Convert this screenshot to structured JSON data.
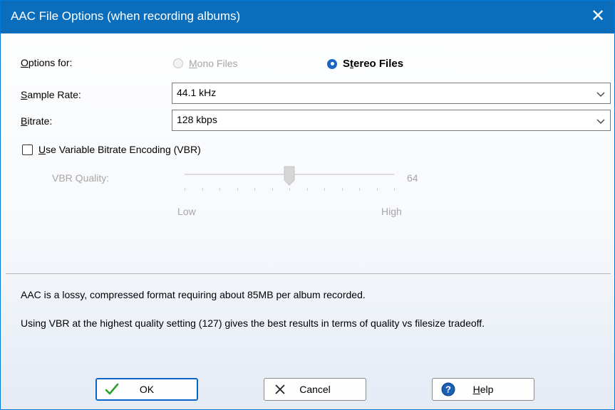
{
  "window": {
    "title": "AAC File Options (when recording albums)",
    "close_glyph": "✕"
  },
  "options_for": {
    "label": "Options for:",
    "mono_label": "Mono Files",
    "mono_selected": false,
    "mono_enabled": false,
    "stereo_label": "Stereo Files",
    "stereo_selected": true
  },
  "sample_rate": {
    "label": "Sample Rate:",
    "value": "44.1 kHz"
  },
  "bitrate": {
    "label": "Bitrate:",
    "value": "128 kbps"
  },
  "vbr": {
    "checkbox_label": "Use Variable Bitrate Encoding (VBR)",
    "checked": false,
    "quality_label": "VBR Quality:",
    "quality_value": "64",
    "quality_fraction": 0.5,
    "low_label": "Low",
    "high_label": "High"
  },
  "info": {
    "line1": "AAC is a lossy, compressed format requiring about 85MB per album recorded.",
    "line2": "Using VBR at the highest quality setting (127) gives the best results in terms of quality vs filesize tradeoff."
  },
  "buttons": {
    "ok_label": "OK",
    "cancel_label": "Cancel",
    "help_label": "Help"
  },
  "icons": {
    "ok": "checkmark-icon",
    "cancel": "x-icon",
    "help": "help-icon",
    "dropdown": "chevron-down-icon"
  },
  "colors": {
    "titlebar": "#0a6ebd",
    "accent": "#1b66c4",
    "ok_check": "#2f9e2f"
  }
}
